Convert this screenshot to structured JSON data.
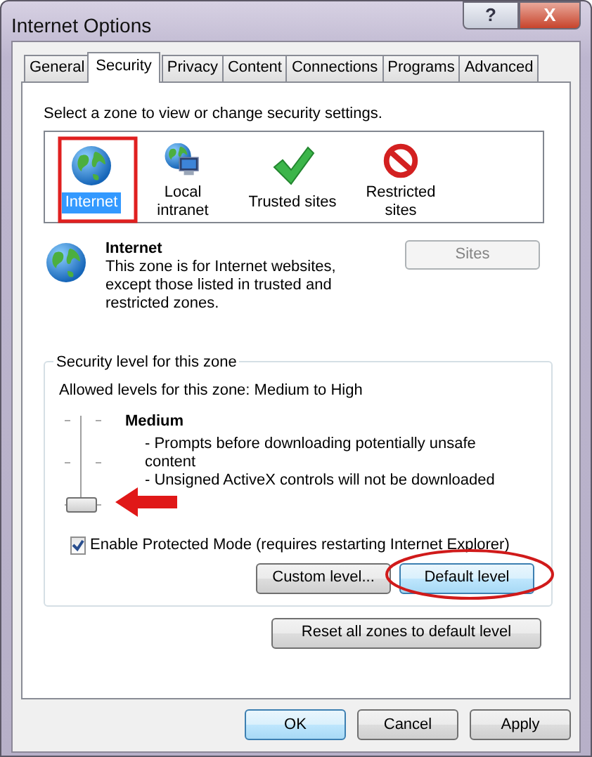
{
  "window": {
    "title": "Internet Options",
    "buttons": [
      {
        "kind": "help",
        "label": "?"
      },
      {
        "kind": "close",
        "label": "X"
      }
    ]
  },
  "tabs": [
    {
      "label": "General",
      "selected": false
    },
    {
      "label": "Security",
      "selected": true
    },
    {
      "label": "Privacy",
      "selected": false
    },
    {
      "label": "Content",
      "selected": false
    },
    {
      "label": "Connections",
      "selected": false
    },
    {
      "label": "Programs",
      "selected": false
    },
    {
      "label": "Advanced",
      "selected": false
    }
  ],
  "zone_prompt": "Select a zone to view or change security settings.",
  "zones": [
    {
      "kind": "internet",
      "label": "Internet",
      "selected": true
    },
    {
      "kind": "intranet",
      "label": "Local intranet",
      "selected": false
    },
    {
      "kind": "trusted",
      "label": "Trusted sites",
      "selected": false
    },
    {
      "kind": "restricted",
      "label": "Restricted sites",
      "selected": false
    }
  ],
  "zone_info": {
    "title": "Internet",
    "description": "This zone is for Internet websites, except those listed in trusted and restricted zones.",
    "sites_button": {
      "label": "Sites",
      "disabled": true
    }
  },
  "security_level": {
    "legend": "Security level for this zone",
    "allowed": "Allowed levels for this zone: Medium to High",
    "level": 0,
    "level_name": "Medium",
    "details": [
      "- Prompts before downloading potentially unsafe content",
      "- Unsigned ActiveX controls will not be downloaded"
    ],
    "protected_mode": {
      "label": "Enable Protected Mode (requires restarting Internet Explorer)",
      "checked": true
    },
    "buttons": [
      {
        "label": "Custom level...",
        "focused": false
      },
      {
        "label": "Default level",
        "focused": true
      }
    ]
  },
  "reset_button": "Reset all zones to default level",
  "dialog_buttons": [
    {
      "label": "OK",
      "default": true
    },
    {
      "label": "Cancel",
      "default": false
    },
    {
      "label": "Apply",
      "default": false
    }
  ],
  "annotations": [
    {
      "kind": "box"
    },
    {
      "kind": "arrow"
    },
    {
      "kind": "ellipse"
    }
  ]
}
